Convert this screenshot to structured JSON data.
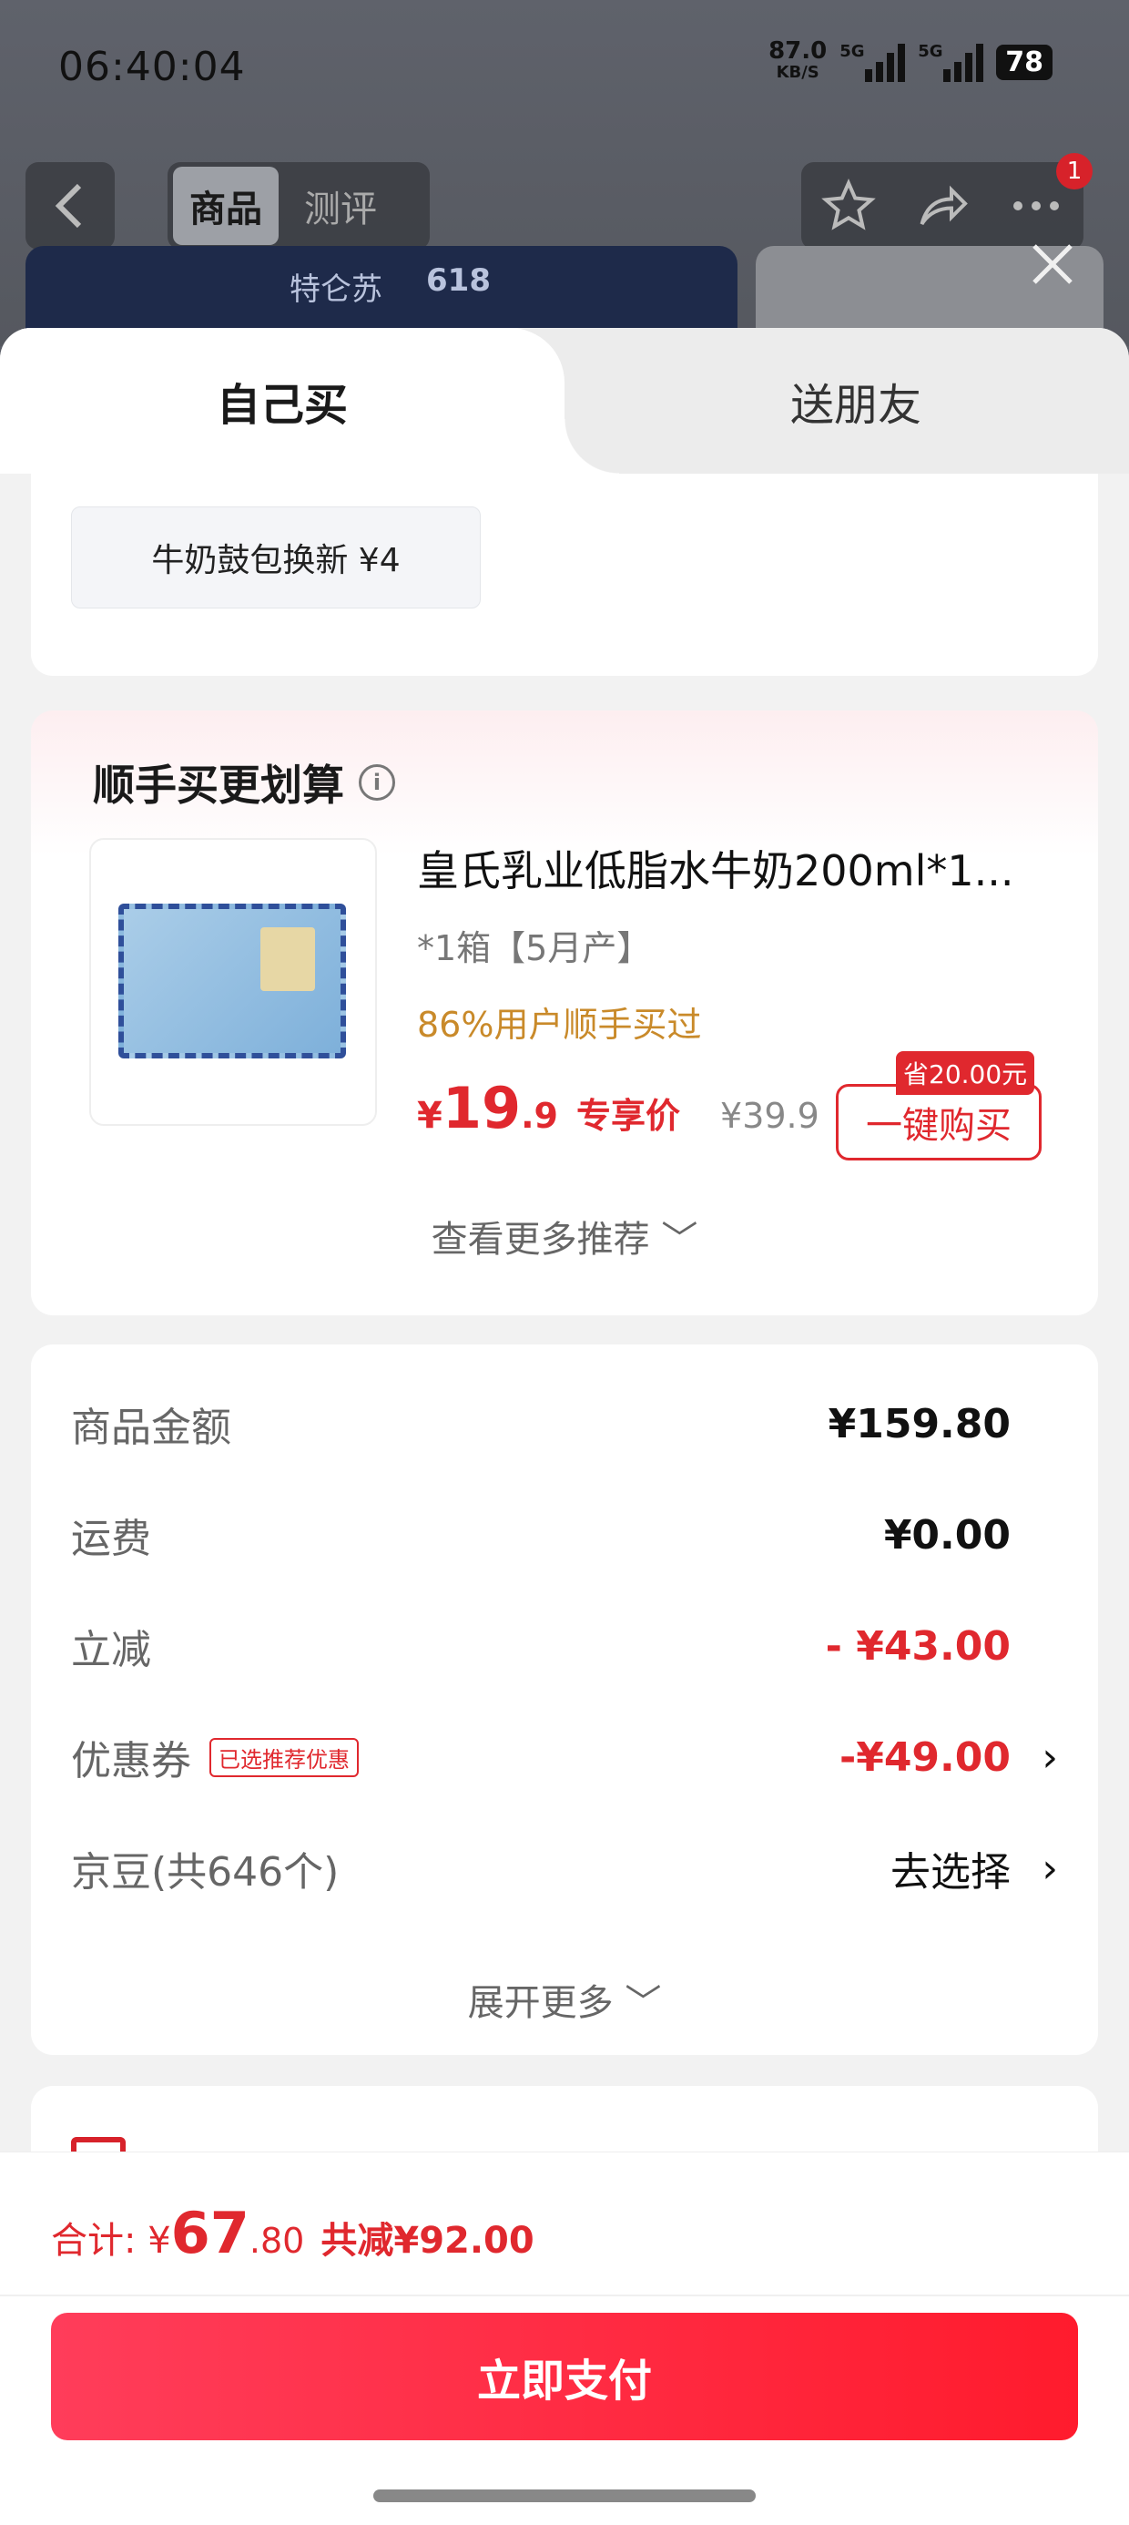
{
  "status_bar": {
    "time": "06:40:04",
    "net_speed": "87.0",
    "net_unit": "KB/S",
    "signal1_label": "5G",
    "signal2_label": "5G",
    "battery": "78"
  },
  "top_nav": {
    "tab_goods": "商品",
    "tab_review": "测评",
    "badge_count": "1",
    "banner_brand": "特仑苏",
    "banner_event": "618"
  },
  "sheet": {
    "tab_self": "自己买",
    "tab_friend": "送朋友",
    "packaging_chip": "牛奶鼓包换新  ¥4"
  },
  "bundle": {
    "title": "顺手买更划算",
    "product_name": "皇氏乳业低脂水牛奶200ml*1...",
    "spec": "*1箱【5月产】",
    "social_proof": "86%用户顺手买过",
    "price_yen": "¥",
    "price_int": "19",
    "price_dec": ".9",
    "price_tag": "专享价",
    "original_price": "¥39.9",
    "save_badge": "省20.00元",
    "buy_button": "一键购买",
    "more_recs": "查看更多推荐 ﹀"
  },
  "summary": {
    "rows": [
      {
        "label": "商品金额",
        "value": "¥159.80"
      },
      {
        "label": "运费",
        "value": "¥0.00"
      },
      {
        "label": "立减",
        "value": "- ¥43.00"
      },
      {
        "label": "优惠券",
        "tag": "已选推荐优惠",
        "value": "-¥49.00"
      },
      {
        "label": "京豆(共646个)",
        "value": "去选择"
      }
    ],
    "expand_more": "展开更多 ﹀"
  },
  "footer": {
    "total_label": "合计: ¥",
    "total_int": "67",
    "total_dec": ".80",
    "total_saved": "共减¥92.00",
    "pay_button": "立即支付"
  },
  "colors": {
    "accent_red": "#e0282e",
    "pay_gradient_start": "#ff3d5a",
    "pay_gradient_end": "#ff1b2d"
  }
}
